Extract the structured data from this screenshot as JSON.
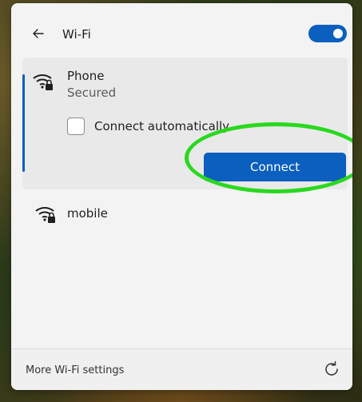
{
  "header": {
    "back_icon": "back-arrow-icon",
    "title": "Wi-Fi",
    "toggle": {
      "state": "on",
      "color": "#0a5fbf"
    }
  },
  "networks": [
    {
      "name": "Phone",
      "status": "Secured",
      "icon": "wifi-secured-icon",
      "expanded": true,
      "connect_automatically_label": "Connect automatically",
      "connect_automatically_checked": false,
      "connect_label": "Connect"
    },
    {
      "name": "mobile",
      "icon": "wifi-secured-icon",
      "expanded": false
    }
  ],
  "annotation": {
    "type": "ellipse-highlight",
    "color": "#2ad81f",
    "target": "connect-button"
  },
  "footer": {
    "more_settings_label": "More Wi-Fi settings",
    "refresh_icon": "refresh-icon"
  },
  "colors": {
    "accent": "#0a5fbf",
    "panel": "#f3f3f3",
    "selected_row": "#e9e9e9"
  }
}
